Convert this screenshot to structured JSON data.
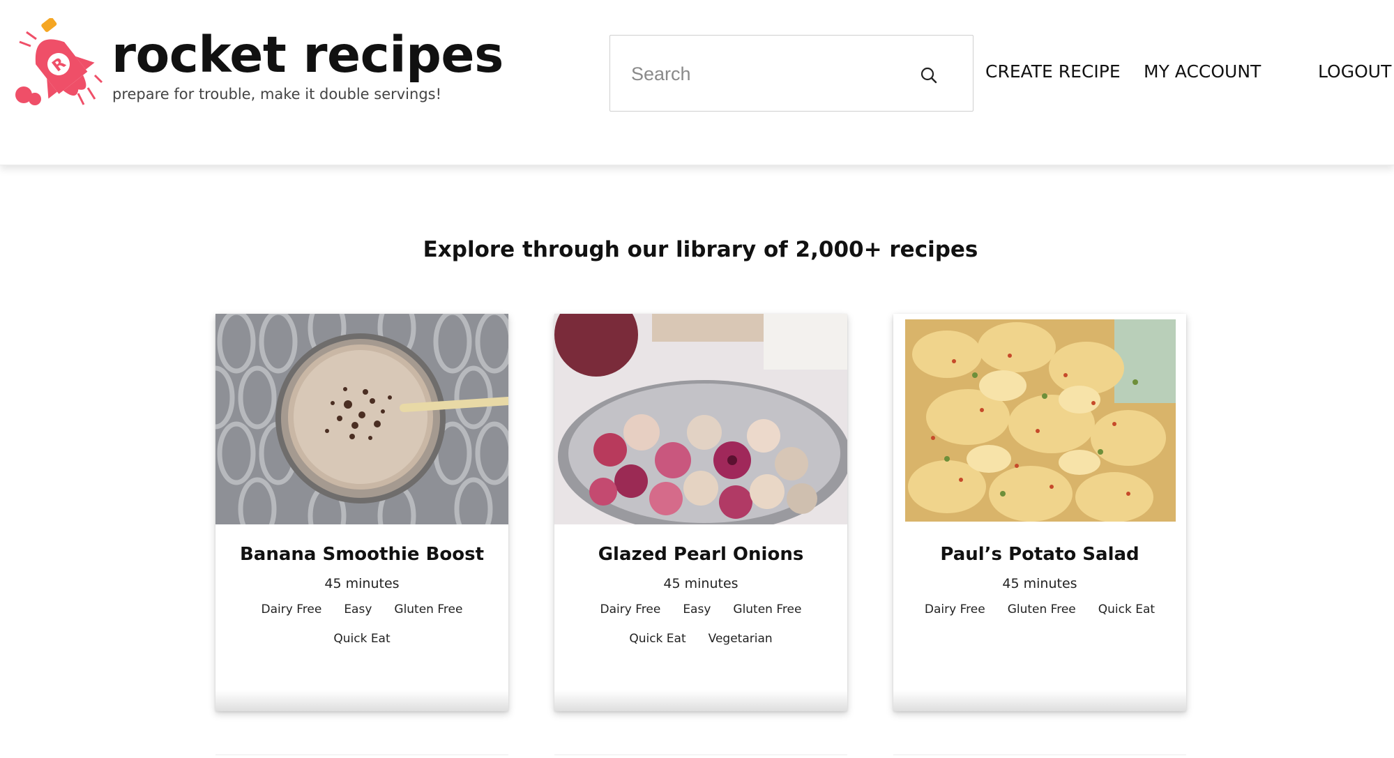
{
  "brand": {
    "name": "rocket recipes",
    "tagline": "prepare for trouble, make it double servings!",
    "accent_color": "#ef4f68",
    "logo_icon": "rocket-logo-icon"
  },
  "search": {
    "placeholder": "Search",
    "value": "",
    "icon": "search-icon"
  },
  "nav": {
    "create_recipe": "CREATE RECIPE",
    "my_account": "MY ACCOUNT",
    "logout": "LOGOUT"
  },
  "main": {
    "headline": "Explore through our library of 2,000+ recipes"
  },
  "recipes": [
    {
      "title": "Banana Smoothie Boost",
      "time": "45 minutes",
      "image": "banana-smoothie-photo",
      "tags": [
        "Dairy Free",
        "Easy",
        "Gluten Free",
        "Quick Eat"
      ]
    },
    {
      "title": "Glazed Pearl Onions",
      "time": "45 minutes",
      "image": "pearl-onions-photo",
      "tags": [
        "Dairy Free",
        "Easy",
        "Gluten Free",
        "Quick Eat",
        "Vegetarian"
      ]
    },
    {
      "title": "Paul’s Potato Salad",
      "time": "45 minutes",
      "image": "potato-salad-photo",
      "tags": [
        "Dairy Free",
        "Gluten Free",
        "Quick Eat"
      ]
    }
  ]
}
